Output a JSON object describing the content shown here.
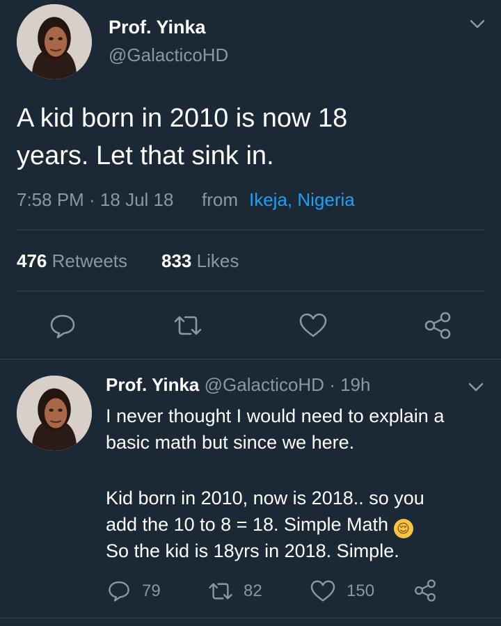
{
  "main_tweet": {
    "display_name": "Prof. Yinka",
    "handle": "@GalacticoHD",
    "text_line1": "A kid born in 2010 is now 18",
    "text_line2": "years. Let that sink in.",
    "time": "7:58 PM · 18 Jul 18",
    "from_label": "from",
    "location": "Ikeja, Nigeria",
    "retweets_count": "476",
    "retweets_label": "Retweets",
    "likes_count": "833",
    "likes_label": "Likes",
    "actions": [
      "reply-icon",
      "retweet-icon",
      "like-icon",
      "share-icon"
    ]
  },
  "reply_tweet": {
    "display_name": "Prof. Yinka",
    "handle": "@GalacticoHD",
    "age": "· 19h",
    "line1": "I never thought I would need to explain a",
    "line2": "basic math but since we here.",
    "line3": "Kid born in 2010, now is 2018.. so you",
    "line4": "add the 10 to 8 = 18. Simple Math",
    "emoji": "😌",
    "line5": "So the kid is 18yrs in 2018. Simple.",
    "reply_count": "79",
    "retweet_count": "82",
    "like_count": "150"
  },
  "colors": {
    "background": "#1b2836",
    "text": "#ffffff",
    "muted": "#8899a6",
    "link": "#1da1f2",
    "divider": "#38444d"
  }
}
